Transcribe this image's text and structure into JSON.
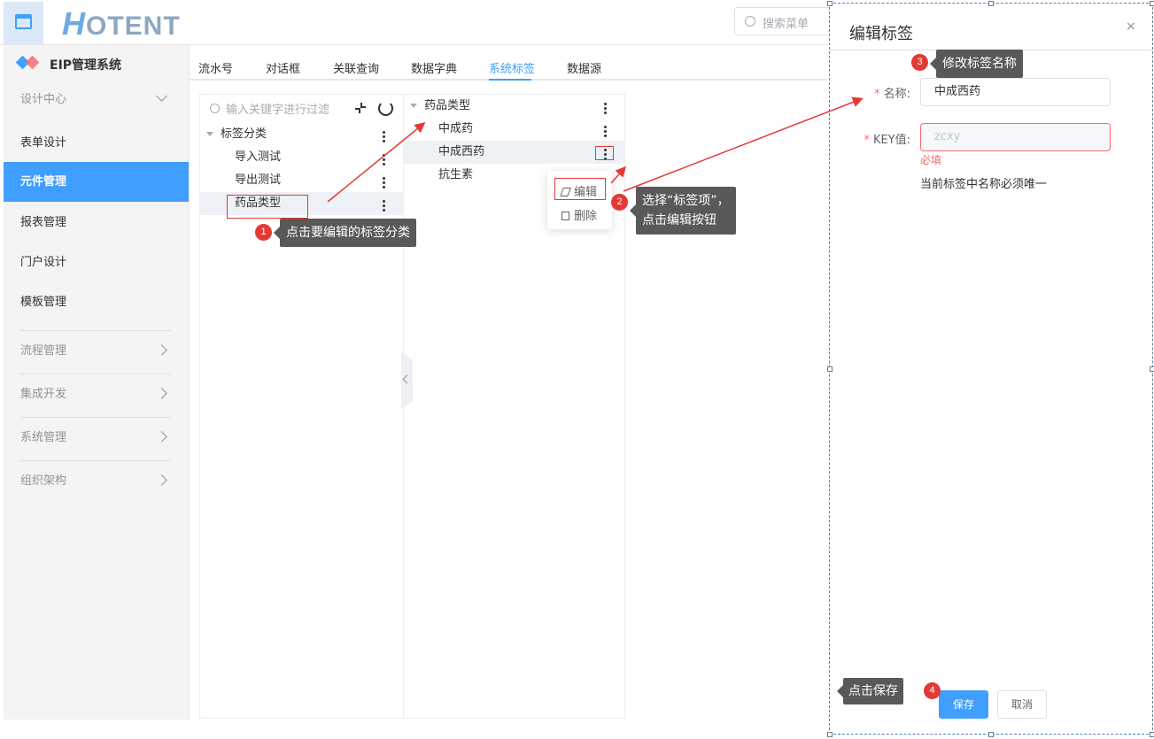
{
  "header": {
    "logo_h": "H",
    "logo_rest": "OTENT",
    "search_placeholder": "搜索菜单"
  },
  "sidebar": {
    "system_title": "EIP管理系统",
    "items": [
      {
        "label": "设计中心"
      },
      {
        "label": "表单设计"
      },
      {
        "label": "元件管理"
      },
      {
        "label": "报表管理"
      },
      {
        "label": "门户设计"
      },
      {
        "label": "模板管理"
      },
      {
        "label": "流程管理"
      },
      {
        "label": "集成开发"
      },
      {
        "label": "系统管理"
      },
      {
        "label": "组织架构"
      }
    ]
  },
  "tabs": [
    {
      "label": "流水号"
    },
    {
      "label": "对话框"
    },
    {
      "label": "关联查询"
    },
    {
      "label": "数据字典"
    },
    {
      "label": "系统标签"
    },
    {
      "label": "数据源"
    }
  ],
  "left_tree": {
    "filter_placeholder": "输入关键字进行过滤",
    "root": "标签分类",
    "children": [
      "导入测试",
      "导出测试",
      "药品类型"
    ]
  },
  "mid_tree": {
    "root": "药品类型",
    "children": [
      "中成药",
      "中成西药",
      "抗生素"
    ]
  },
  "context_menu": {
    "edit": "编辑",
    "delete": "删除"
  },
  "drawer": {
    "title": "编辑标签",
    "close": "×",
    "name_label": "名称:",
    "name_value": "中成西药",
    "key_label": "KEY值:",
    "key_placeholder": "zcxy",
    "required_msg": "必填",
    "hint": "当前标签中名称必须唯一",
    "save": "保存",
    "cancel": "取消"
  },
  "annotations": {
    "step1": {
      "num": "1",
      "text": "点击要编辑的标签分类"
    },
    "step2": {
      "num": "2",
      "line1": "选择“标签项”，",
      "line2": "点击编辑按钮"
    },
    "step3": {
      "num": "3",
      "text": "修改标签名称"
    },
    "step4": {
      "num": "4",
      "text": "点击保存"
    },
    "color": "#e53935"
  },
  "colors": {
    "primary": "#409eff",
    "danger": "#f56c6c",
    "callout_bg": "#595959"
  }
}
